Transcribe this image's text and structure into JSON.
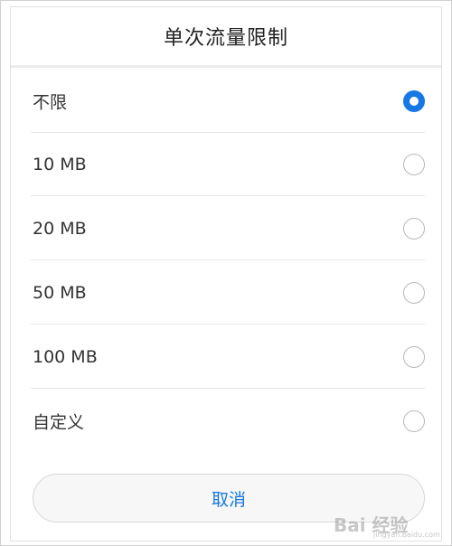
{
  "dialog": {
    "title": "单次流量限制",
    "options": [
      {
        "label": "不限",
        "selected": true
      },
      {
        "label": "10 MB",
        "selected": false
      },
      {
        "label": "20 MB",
        "selected": false
      },
      {
        "label": "50 MB",
        "selected": false
      },
      {
        "label": "100 MB",
        "selected": false
      },
      {
        "label": "自定义",
        "selected": false
      }
    ],
    "cancel_label": "取消"
  },
  "watermark": {
    "text": "Bai 经验",
    "url": "jingyan.baidu.com"
  },
  "colors": {
    "accent": "#1678e4",
    "radio_unselected": "#b8b8b8",
    "divider": "#e6e6e6"
  },
  "icons": {
    "radio_selected": "radio-selected-icon",
    "radio_unselected": "radio-unselected-icon"
  }
}
